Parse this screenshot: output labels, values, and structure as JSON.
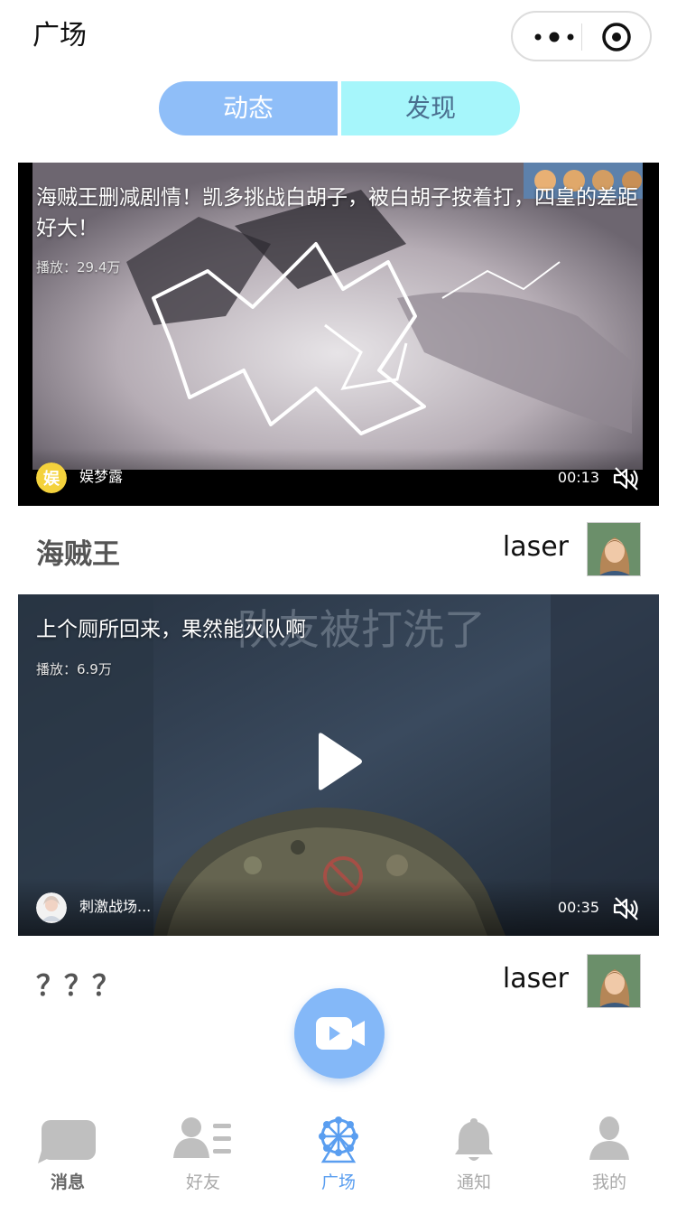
{
  "header": {
    "title": "广场"
  },
  "tabs": [
    {
      "label": "动态",
      "active": true
    },
    {
      "label": "发现",
      "active": false
    }
  ],
  "videos": [
    {
      "title": "海贼王删减剧情！凯多挑战白胡子，被白胡子按着打，四皇的差距好大！",
      "plays": "播放：29.4万",
      "author": "娱梦露",
      "duration": "00:13",
      "post_title": "海贼王",
      "post_user": "laser"
    },
    {
      "title": "上个厕所回来，果然能灭队啊",
      "plays": "播放：6.9万",
      "author": "刺激战场...",
      "duration": "00:35",
      "post_title": "？？？",
      "post_user": "laser"
    }
  ],
  "tabbar": [
    {
      "label": "消息",
      "icon": "chat-icon"
    },
    {
      "label": "好友",
      "icon": "friends-icon"
    },
    {
      "label": "广场",
      "icon": "ferris-wheel-icon",
      "active": true
    },
    {
      "label": "通知",
      "icon": "bell-icon"
    },
    {
      "label": "我的",
      "icon": "user-icon"
    }
  ],
  "colors": {
    "accent": "#5a9ef0",
    "tab_left": "#8fbef8",
    "tab_right": "#a6f6fb",
    "fab": "#84b8f8"
  }
}
